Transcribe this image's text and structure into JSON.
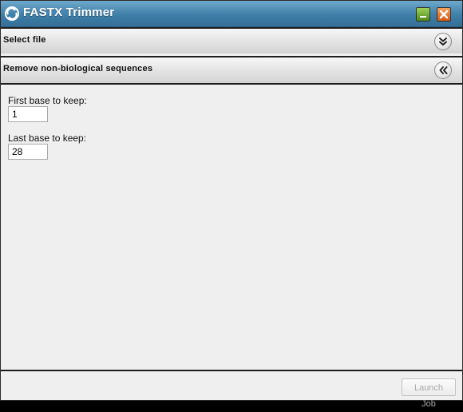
{
  "window": {
    "title": "FASTX Trimmer",
    "icons": {
      "app": "app-logo-icon",
      "minimize": "minimize-icon",
      "close": "close-icon"
    }
  },
  "sections": [
    {
      "label": "Select file",
      "state": "collapsed",
      "icon": "double-chevron-down-icon"
    },
    {
      "label": "Remove non-biological sequences",
      "state": "expanded",
      "icon": "double-chevron-left-icon"
    }
  ],
  "form": {
    "first_base": {
      "label": "First base to keep:",
      "value": "1"
    },
    "last_base": {
      "label": "Last base to keep:",
      "value": "28"
    }
  },
  "footer": {
    "launch_label": "Launch Job",
    "launch_enabled": false
  },
  "colors": {
    "titlebar": "#3f7fa8",
    "minimize": "#4b8a18",
    "close": "#d35a12",
    "panel": "#efefef"
  }
}
